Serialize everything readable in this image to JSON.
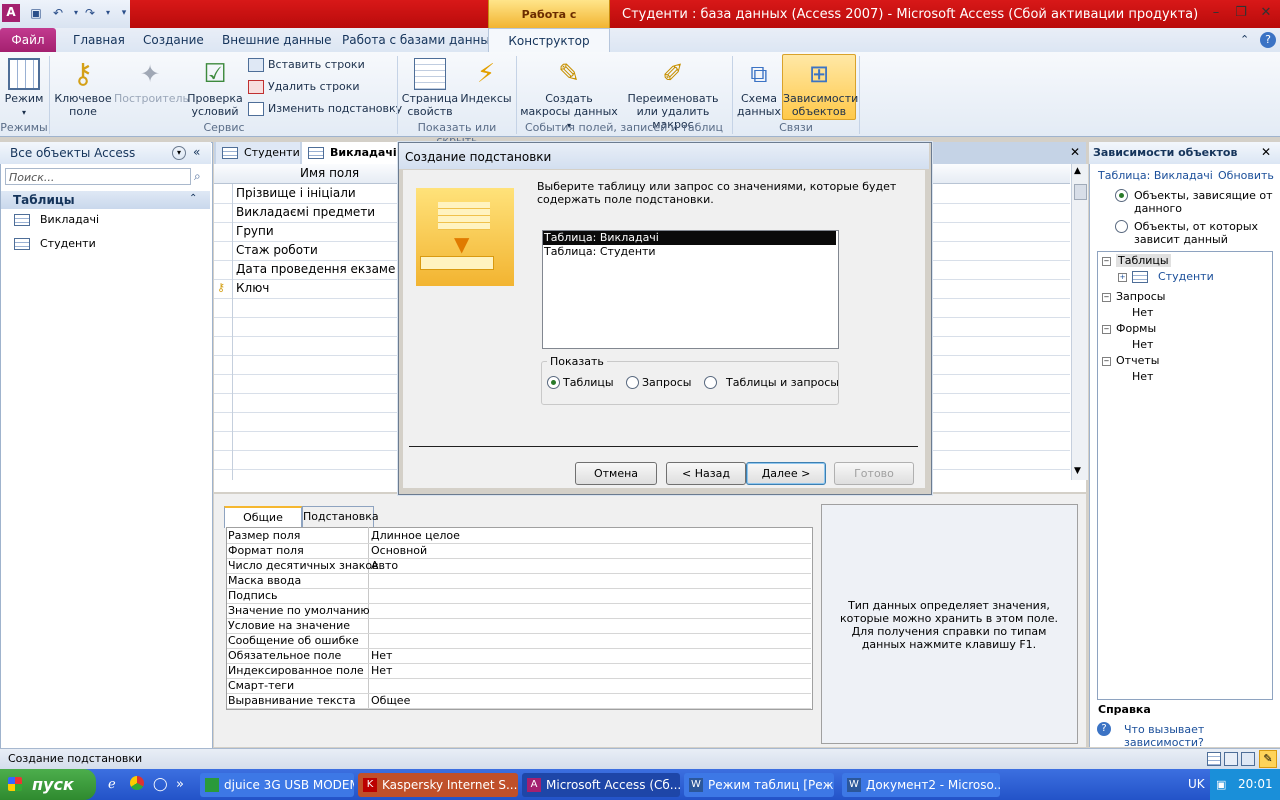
{
  "titlebar": {
    "context_tab": "Работа с таблицами",
    "window_title": "Студенти : база данных (Access 2007)  -  Microsoft Access (Сбой активации продукта)"
  },
  "tabs": {
    "file": "Файл",
    "home": "Главная",
    "create": "Создание",
    "external": "Внешние данные",
    "dbtools": "Работа с базами данных",
    "design": "Конструктор"
  },
  "ribbon": {
    "view": "Режим",
    "primary_key": "Ключевое поле",
    "builder": "Построитель",
    "test_rules": "Проверка условий",
    "insert_rows": "Вставить строки",
    "delete_rows": "Удалить строки",
    "modify_lookups": "Изменить подстановку",
    "property_sheet": "Страница свойств",
    "indexes": "Индексы",
    "create_macros": "Создать макросы данных",
    "rename_macro": "Переименовать или удалить макрос",
    "relationships": "Схема данных",
    "dependencies": "Зависимости объектов",
    "groups": {
      "views": "Режимы",
      "tools": "Сервис",
      "show_hide": "Показать или скрыть",
      "events": "События полей, записей и таблиц",
      "relations": "Связи"
    }
  },
  "nav": {
    "title": "Все объекты Access",
    "search_placeholder": "Поиск...",
    "group": "Таблицы",
    "items": [
      "Викладачі",
      "Студенти"
    ]
  },
  "doctabs": [
    "Студенти",
    "Викладачі"
  ],
  "grid": {
    "header": "Имя поля",
    "fields": [
      "Прізвище і ініціали",
      "Викладаємі предмети",
      "Групи",
      "Стаж роботи",
      "Дата проведення екзаме",
      "Ключ"
    ]
  },
  "props": {
    "tabs": [
      "Общие",
      "Подстановка"
    ],
    "rows": [
      [
        "Размер поля",
        "Длинное целое"
      ],
      [
        "Формат поля",
        "Основной"
      ],
      [
        "Число десятичных знаков",
        "Авто"
      ],
      [
        "Маска ввода",
        ""
      ],
      [
        "Подпись",
        ""
      ],
      [
        "Значение по умолчанию",
        ""
      ],
      [
        "Условие на значение",
        ""
      ],
      [
        "Сообщение об ошибке",
        ""
      ],
      [
        "Обязательное поле",
        "Нет"
      ],
      [
        "Индексированное поле",
        "Нет"
      ],
      [
        "Смарт-теги",
        ""
      ],
      [
        "Выравнивание текста",
        "Общее"
      ]
    ],
    "help": "Тип данных определяет значения, которые можно хранить в этом поле. Для получения справки по типам данных нажмите клавишу F1."
  },
  "dialog": {
    "title": "Создание подстановки",
    "prompt": "Выберите таблицу или запрос со значениями, которые будет содержать поле подстановки.",
    "list": [
      "Таблица: Викладачі",
      "Таблица: Студенти"
    ],
    "show_label": "Показать",
    "radios": [
      "Таблицы",
      "Запросы",
      "Таблицы и запросы"
    ],
    "buttons": {
      "cancel": "Отмена",
      "back": "< Назад",
      "next": "Далее >",
      "finish": "Готово"
    }
  },
  "deps": {
    "title": "Зависимости объектов",
    "table_label": "Таблица: Викладачі",
    "refresh": "Обновить",
    "opt1": "Объекты, зависящие от данного",
    "opt2": "Объекты, от которых зависит данный",
    "tree": {
      "tables": "Таблицы",
      "students": "Студенти",
      "queries": "Запросы",
      "forms": "Формы",
      "reports": "Отчеты",
      "none": "Нет"
    },
    "help_header": "Справка",
    "help_link": "Что вызывает зависимости?"
  },
  "status": {
    "text": "Создание подстановки"
  },
  "taskbar": {
    "start": "пуск",
    "tasks": [
      "djuice 3G USB MODEM",
      "Kaspersky Internet S...",
      "Microsoft Access (Сб...",
      "Режим таблиц [Режи...",
      "Документ2 - Microso..."
    ],
    "lang": "UK",
    "clock": "20:01"
  }
}
